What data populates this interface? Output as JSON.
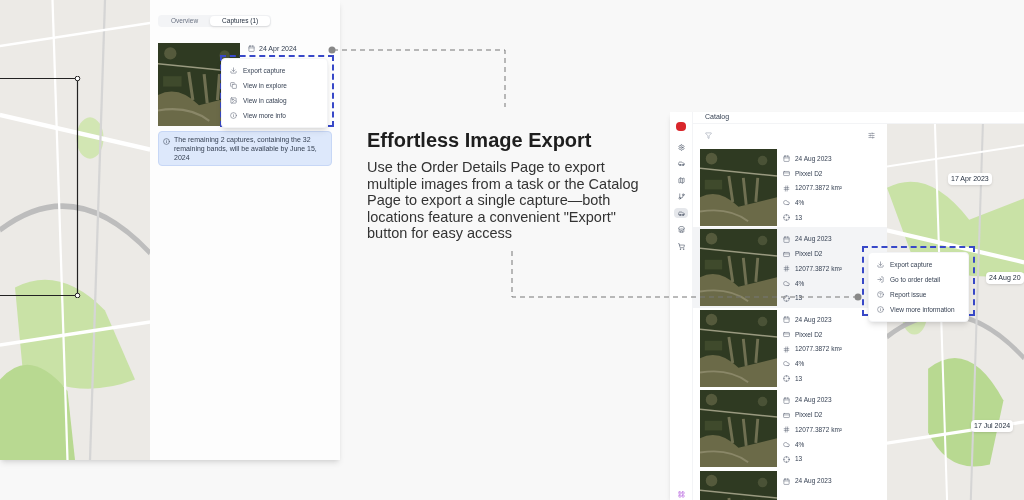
{
  "order_window": {
    "tabs": [
      {
        "label": "Overview",
        "selected": false
      },
      {
        "label": "Captures (1)",
        "selected": true
      }
    ],
    "capture": {
      "date": "24 Apr 2024"
    },
    "menu": [
      {
        "kind": "export",
        "label": "Export capture"
      },
      {
        "kind": "explore",
        "label": "View in explore"
      },
      {
        "kind": "catalog",
        "label": "View in catalog"
      },
      {
        "kind": "info",
        "label": "View more info"
      }
    ],
    "notice": "The remaining 2 captures, containing the 32 remaining bands, will be available by June 15, 2024"
  },
  "feature": {
    "title": "Effortless Image Export",
    "body": "Use the Order Details Page to export multiple images from a task or the Catalog Page to export a single capture—both locations feature a convenient \"Export\" button for easy access"
  },
  "catalog_window": {
    "title": "Catalog",
    "sidebar": [
      {
        "kind": "settings",
        "selected": false
      },
      {
        "kind": "vehicle",
        "selected": false
      },
      {
        "kind": "map",
        "selected": false
      },
      {
        "kind": "route",
        "selected": false
      },
      {
        "kind": "vehicle",
        "selected": true
      },
      {
        "kind": "store",
        "selected": false
      },
      {
        "kind": "cart",
        "selected": false
      },
      {
        "kind": "app",
        "selected": false
      }
    ],
    "rows": [
      {
        "date": "24 Aug 2023",
        "satellite": "Pixxel D2",
        "area": "12077.3872 km²",
        "cloud": "4%",
        "bands": "13",
        "selected": false
      },
      {
        "date": "24 Aug 2023",
        "satellite": "Pixxel D2",
        "area": "12077.3872 km²",
        "cloud": "4%",
        "bands": "13",
        "selected": true
      },
      {
        "date": "24 Aug 2023",
        "satellite": "Pixxel D2",
        "area": "12077.3872 km²",
        "cloud": "4%",
        "bands": "13",
        "selected": false
      },
      {
        "date": "24 Aug 2023",
        "satellite": "Pixxel D2",
        "area": "12077.3872 km²",
        "cloud": "4%",
        "bands": "13",
        "selected": false
      },
      {
        "date": "24 Aug 2023",
        "selected": false
      }
    ],
    "menu": [
      {
        "kind": "export",
        "label": "Export capture"
      },
      {
        "kind": "order",
        "label": "Go to order detail"
      },
      {
        "kind": "report",
        "label": "Report issue"
      },
      {
        "kind": "info",
        "label": "View more information"
      }
    ],
    "map_labels": [
      "17 Apr 2023",
      "24 Aug 20",
      "17 Jul 2024"
    ]
  }
}
